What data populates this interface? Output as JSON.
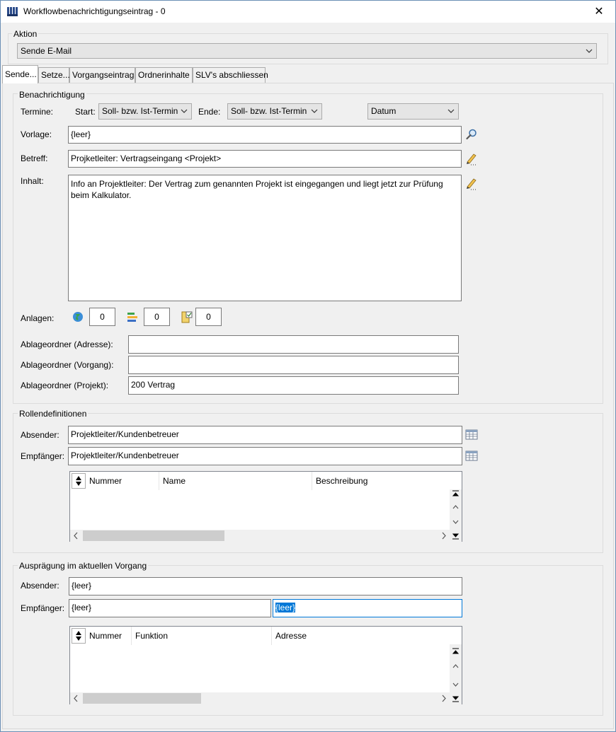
{
  "window": {
    "title": "Workflowbenachrichtigungseintrag - 0",
    "close_symbol": "✕"
  },
  "aktion": {
    "legend": "Aktion",
    "selected": "Sende E-Mail"
  },
  "tabs": [
    "Sende...",
    "Setze...",
    "Vorgangseintrag",
    "Ordnerinhalte",
    "SLV's abschliessen"
  ],
  "benachrichtigung": {
    "legend": "Benachrichtigung",
    "termine_label": "Termine:",
    "start_label": "Start:",
    "start_value": "Soll- bzw. Ist-Termin",
    "ende_label": "Ende:",
    "ende_value": "Soll- bzw. Ist-Termin",
    "datum_value": "Datum",
    "vorlage_label": "Vorlage:",
    "vorlage_value": "{leer}",
    "betreff_label": "Betreff:",
    "betreff_value": "Projketleiter: Vertragseingang <Projekt>",
    "inhalt_label": "Inhalt:",
    "inhalt_value": "Info an Projektleiter: Der Vertrag zum genannten Projekt ist eingegangen und liegt jetzt zur Prüfung beim Kalkulator.",
    "anlagen_label": "Anlagen:",
    "anlagen_counts": [
      "0",
      "0",
      "0"
    ],
    "ablage_adresse_label": "Ablageordner (Adresse):",
    "ablage_adresse_value": "",
    "ablage_vorgang_label": "Ablageordner (Vorgang):",
    "ablage_vorgang_value": "",
    "ablage_projekt_label": "Ablageordner (Projekt):",
    "ablage_projekt_value": "200 Vertrag"
  },
  "rollen": {
    "legend": "Rollendefinitionen",
    "absender_label": "Absender:",
    "absender_value": "Projektleiter/Kundenbetreuer",
    "empfaenger_label": "Empfänger:",
    "empfaenger_value": "Projektleiter/Kundenbetreuer",
    "columns": [
      "Nummer",
      "Name",
      "Beschreibung"
    ]
  },
  "auspraegung": {
    "legend": "Ausprägung im aktuellen Vorgang",
    "absender_label": "Absender:",
    "absender_value": "{leer}",
    "empfaenger_label": "Empfänger:",
    "empfaenger_value": "{leer}",
    "empfaenger_value2": "{leer}",
    "columns": [
      "Nummer",
      "Funktion",
      "Adresse"
    ]
  }
}
